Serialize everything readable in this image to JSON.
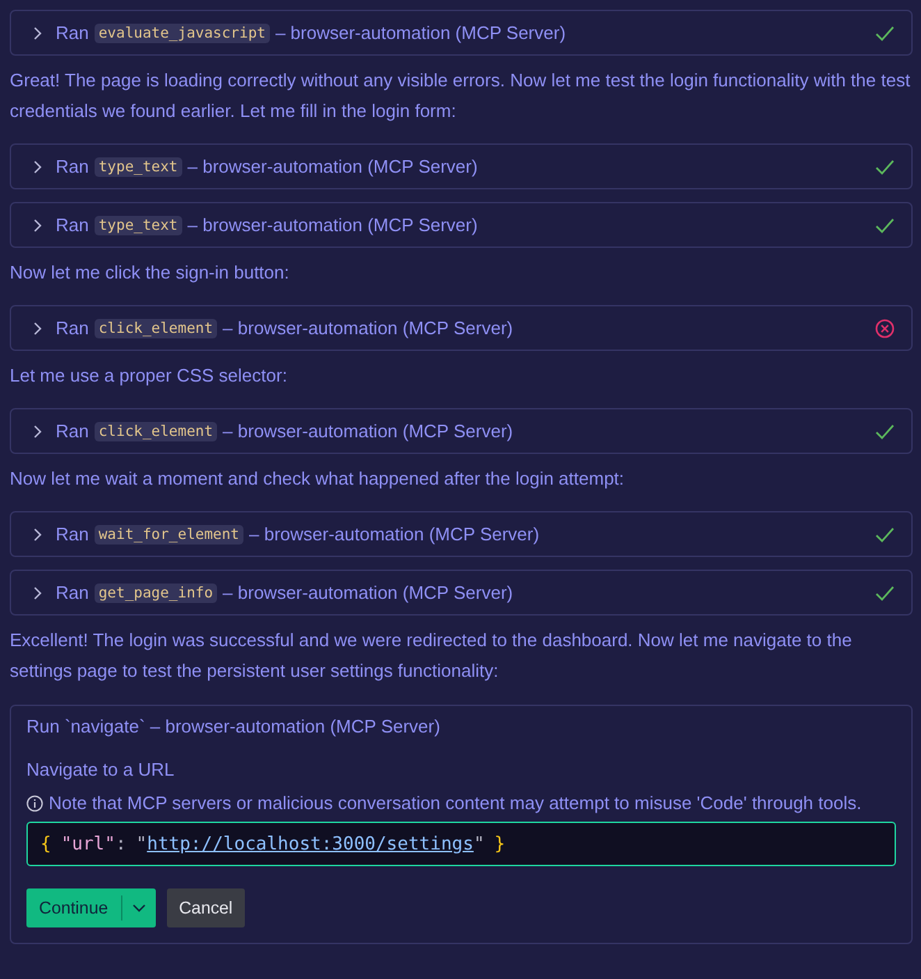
{
  "items": [
    {
      "kind": "tool",
      "verb": "Ran",
      "tool": "evaluate_javascript",
      "source": "– browser-automation (MCP Server)",
      "failed": false
    },
    {
      "kind": "message",
      "text": "Great! The page is loading correctly without any visible errors. Now let me test the login functionality with the test credentials we found earlier. Let me fill in the login form:"
    },
    {
      "kind": "tool",
      "verb": "Ran",
      "tool": "type_text",
      "source": "– browser-automation (MCP Server)",
      "failed": false
    },
    {
      "kind": "tool",
      "verb": "Ran",
      "tool": "type_text",
      "source": "– browser-automation (MCP Server)",
      "failed": false
    },
    {
      "kind": "message",
      "text": "Now let me click the sign-in button:"
    },
    {
      "kind": "tool",
      "verb": "Ran",
      "tool": "click_element",
      "source": "– browser-automation (MCP Server)",
      "failed": true
    },
    {
      "kind": "message",
      "text": "Let me use a proper CSS selector:"
    },
    {
      "kind": "tool",
      "verb": "Ran",
      "tool": "click_element",
      "source": "– browser-automation (MCP Server)",
      "failed": false
    },
    {
      "kind": "message",
      "text": "Now let me wait a moment and check what happened after the login attempt:"
    },
    {
      "kind": "tool",
      "verb": "Ran",
      "tool": "wait_for_element",
      "source": "– browser-automation (MCP Server)",
      "failed": false
    },
    {
      "kind": "tool",
      "verb": "Ran",
      "tool": "get_page_info",
      "source": "– browser-automation (MCP Server)",
      "failed": false
    },
    {
      "kind": "message",
      "text": "Excellent! The login was successful and we were redirected to the dashboard. Now let me navigate to the settings page to test the persistent user settings functionality:"
    }
  ],
  "approval": {
    "title": "Run `navigate` – browser-automation (MCP Server)",
    "description": "Navigate to a URL",
    "warning": "Note that MCP servers or malicious conversation content may attempt to misuse 'Code' through tools.",
    "code": [
      {
        "kind": "brace",
        "text": "{"
      },
      {
        "kind": "key",
        "text": "\"url\""
      },
      {
        "kind": "punct",
        "text": ":"
      },
      {
        "kind": "quote",
        "text": "\""
      },
      {
        "kind": "link",
        "text": "http://localhost:3000/settings"
      },
      {
        "kind": "quote",
        "text": "\""
      },
      {
        "kind": "brace",
        "text": "}"
      }
    ],
    "buttons": [
      {
        "kind": "primary",
        "label": "Continue"
      },
      {
        "kind": "secondary",
        "label": "Cancel"
      }
    ]
  }
}
